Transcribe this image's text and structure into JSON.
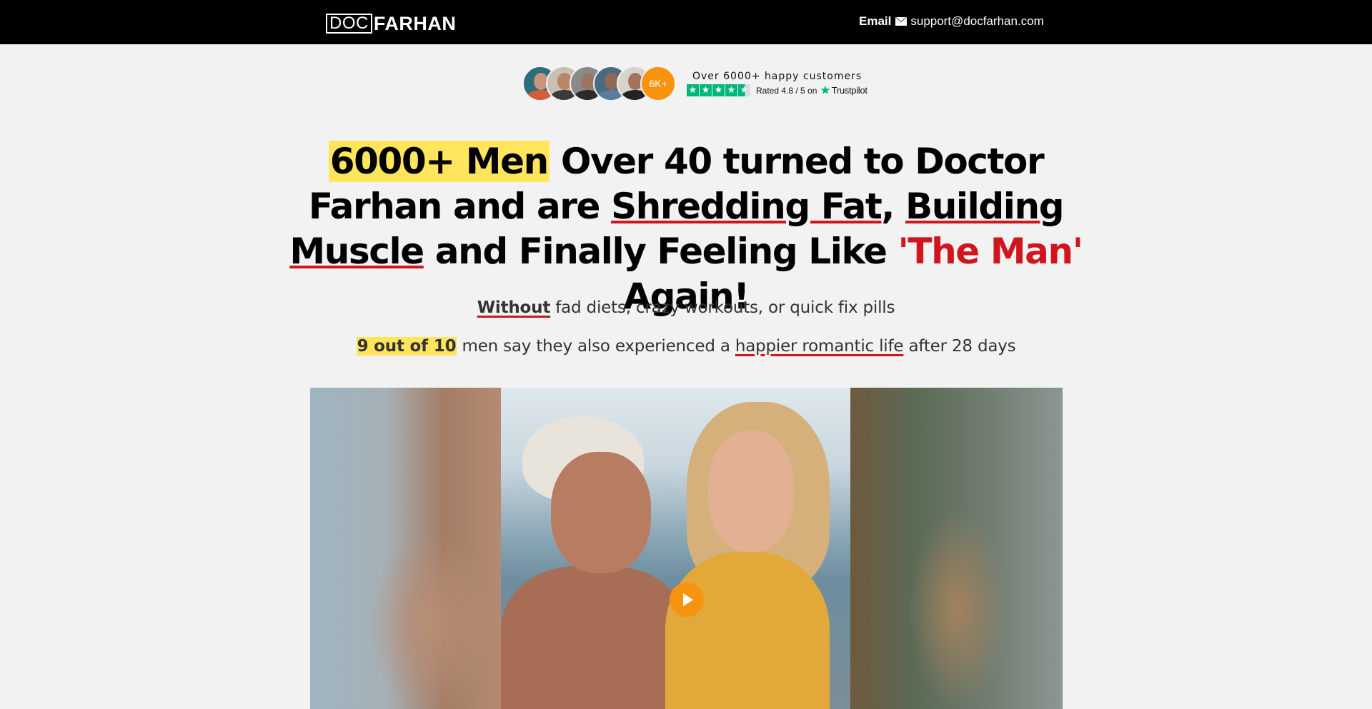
{
  "header": {
    "logo_doc": "DOC",
    "logo_farhan": "FARHAN",
    "email_label": "Email",
    "email_address": "support@docfarhan.com"
  },
  "social_proof": {
    "badge": "6K+",
    "customers": "Over 6000+ happy customers",
    "rated": "Rated 4.8 / 5 on",
    "platform": "Trustpilot",
    "stars": 4.5
  },
  "headline": {
    "highlight": "6000+ Men",
    "part1": " Over 40 turned to Doctor Farhan and are ",
    "ul1": "Shredding Fat",
    "comma": ", ",
    "ul2": "Building Muscle",
    "part2": " and Finally Feeling Like ",
    "red": "'The Man'",
    "part3": " Again!"
  },
  "subheadline": {
    "bold": "Without",
    "rest": " fad diets, crazy workouts, or quick fix pills"
  },
  "stat_line": {
    "highlight": "9 out of 10",
    "middle": " men say they also experienced a ",
    "underlined": "happier romantic life",
    "end": " after 28 days"
  },
  "video": {
    "play_icon": "play-icon"
  },
  "colors": {
    "accent_orange": "#f7930e",
    "highlight_yellow": "#ffe55c",
    "underline_red": "#d0151d",
    "trustpilot_green": "#00b67a"
  }
}
